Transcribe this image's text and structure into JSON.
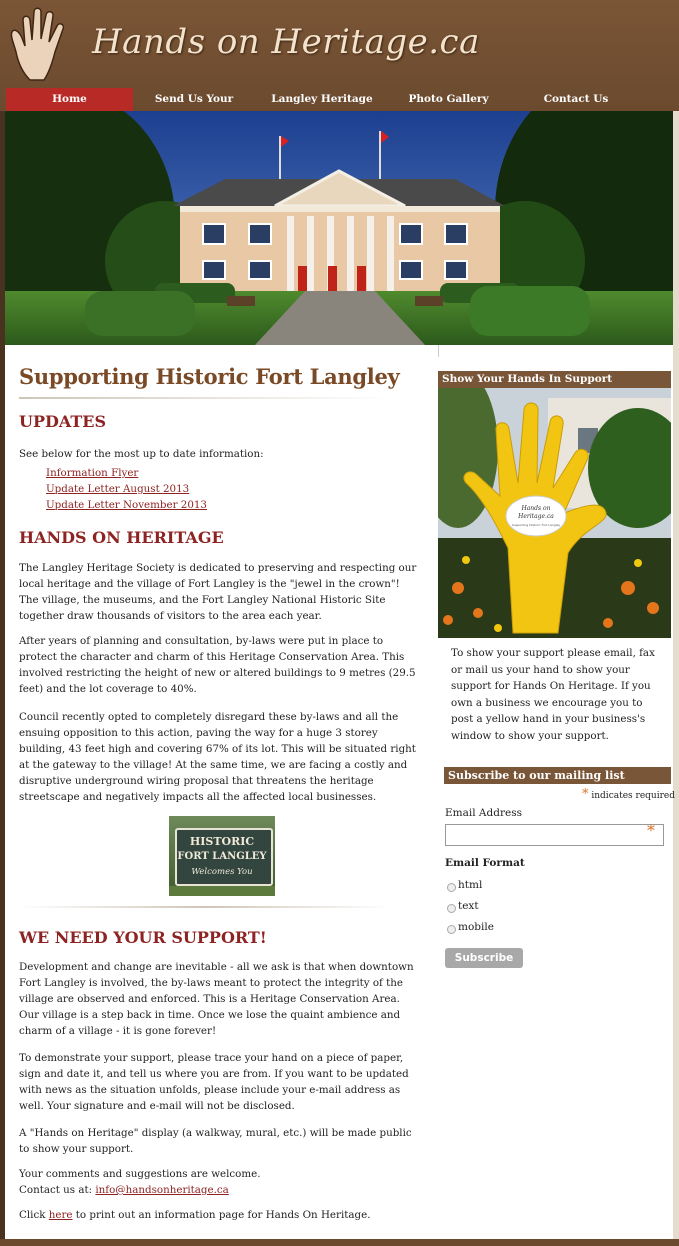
{
  "site": {
    "title": "Hands on Heritage.ca"
  },
  "nav": {
    "items": [
      {
        "label": "Home"
      },
      {
        "label": "Send Us Your Hand"
      },
      {
        "label": "Langley Heritage Society"
      },
      {
        "label": "Photo Gallery"
      },
      {
        "label": "Contact Us"
      }
    ]
  },
  "main": {
    "title": "Supporting Historic Fort Langley",
    "updates_heading": "UPDATES",
    "updates_intro": "See below for the most up to date information:",
    "updates_links": [
      "Information Flyer",
      "Update Letter August 2013",
      "Update Letter November 2013"
    ],
    "hoh_heading": "HANDS ON HERITAGE",
    "hoh_p1": "The Langley Heritage Society is dedicated to preserving and respecting our local heritage and the village of Fort Langley is the \"jewel in the crown\"! The village, the museums, and the Fort Langley National Historic Site together draw thousands of visitors to the area each year.",
    "hoh_p2": "After years of planning and consultation, by-laws were put in place to protect the character and charm of this Heritage Conservation Area. This involved restricting the height of new or altered buildings to 9 metres (29.5 feet) and the lot coverage to 40%.",
    "hoh_p3": "Council recently opted to completely disregard these by-laws and all the ensuing opposition to this action, paving the way for a huge 3 storey building, 43 feet high and covering 67% of its lot. This will be situated right at the gateway to the village! At the same time, we are facing a costly and disruptive underground wiring proposal that threatens the heritage streetscape and negatively impacts all the affected local businesses.",
    "sign_line1": "HISTORIC",
    "sign_line2": "FORT LANGLEY",
    "sign_line3": "Welcomes You",
    "support_heading": "WE NEED YOUR SUPPORT!",
    "support_p1": "Development and change are inevitable - all we ask is that when downtown Fort Langley is involved, the by-laws meant to protect the integrity of the village are observed and enforced. This is a Heritage Conservation Area. Our village is a step back in time. Once we lose the quaint ambience and charm of a village - it is gone forever!",
    "support_p2": "To demonstrate your support, please trace your hand on a piece of paper, sign and date it, and tell us where you are from. If you want to be updated with news as the situation unfolds, please include your e-mail address as well. Your signature and e-mail will not be disclosed.",
    "support_p3": "A \"Hands on Heritage\" display (a walkway, mural, etc.) will be made public to show your support.",
    "support_p4a": "Your comments and suggestions are welcome.",
    "support_p4b": "Contact us at: ",
    "contact_email": "info@handsonheritage.ca",
    "click_pre": "Click ",
    "click_link": "here",
    "click_post": " to print out an information page for Hands On Heritage."
  },
  "sidebar": {
    "hands_heading": "Show Your Hands In Support",
    "hand_sign_line1": "Hands on",
    "hand_sign_line2": "Heritage.ca",
    "hand_sign_line3": "Supporting Historic Fort Langley",
    "hands_text": "To show your support please email, fax or mail us your hand to show your support for Hands On Heritage. If you own a business we encourage you to post a yellow hand in your business's window to show your support.",
    "subscribe_heading": "Subscribe to our mailing list",
    "required_note": "indicates required",
    "email_label": "Email Address",
    "format_label": "Email Format",
    "formats": [
      "html",
      "text",
      "mobile"
    ],
    "subscribe_button": "Subscribe"
  },
  "colors": {
    "brand_brown": "#7a5638",
    "nav_active": "#b72a26",
    "heading_red": "#8d2322",
    "title_brown": "#7a4a26",
    "hand_yellow": "#f2c513"
  }
}
